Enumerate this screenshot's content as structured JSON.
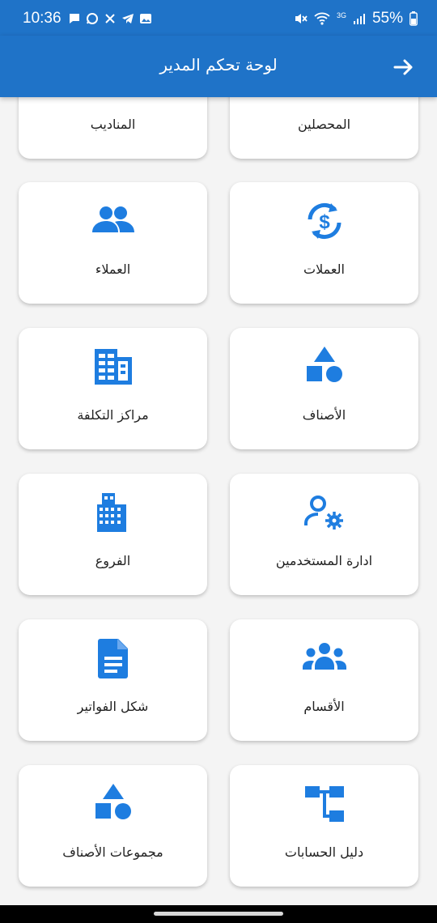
{
  "status_bar": {
    "time": "10:36",
    "network": "3G",
    "battery": "55%"
  },
  "header": {
    "title": "لوحة تحكم المدير"
  },
  "cards": {
    "collectors": "المحصلين",
    "delegates": "المناديب",
    "currencies": "العملات",
    "customers": "العملاء",
    "categories": "الأصناف",
    "cost_centers": "مراكز التكلفة",
    "user_management": "ادارة المستخدمين",
    "branches": "الفروع",
    "departments": "الأقسام",
    "invoice_form": "شكل الفواتير",
    "chart_of_accounts": "دليل الحسابات",
    "category_groups": "مجموعات الأصناف"
  },
  "colors": {
    "primary": "#1f73c8",
    "icon": "#1e7de0"
  }
}
